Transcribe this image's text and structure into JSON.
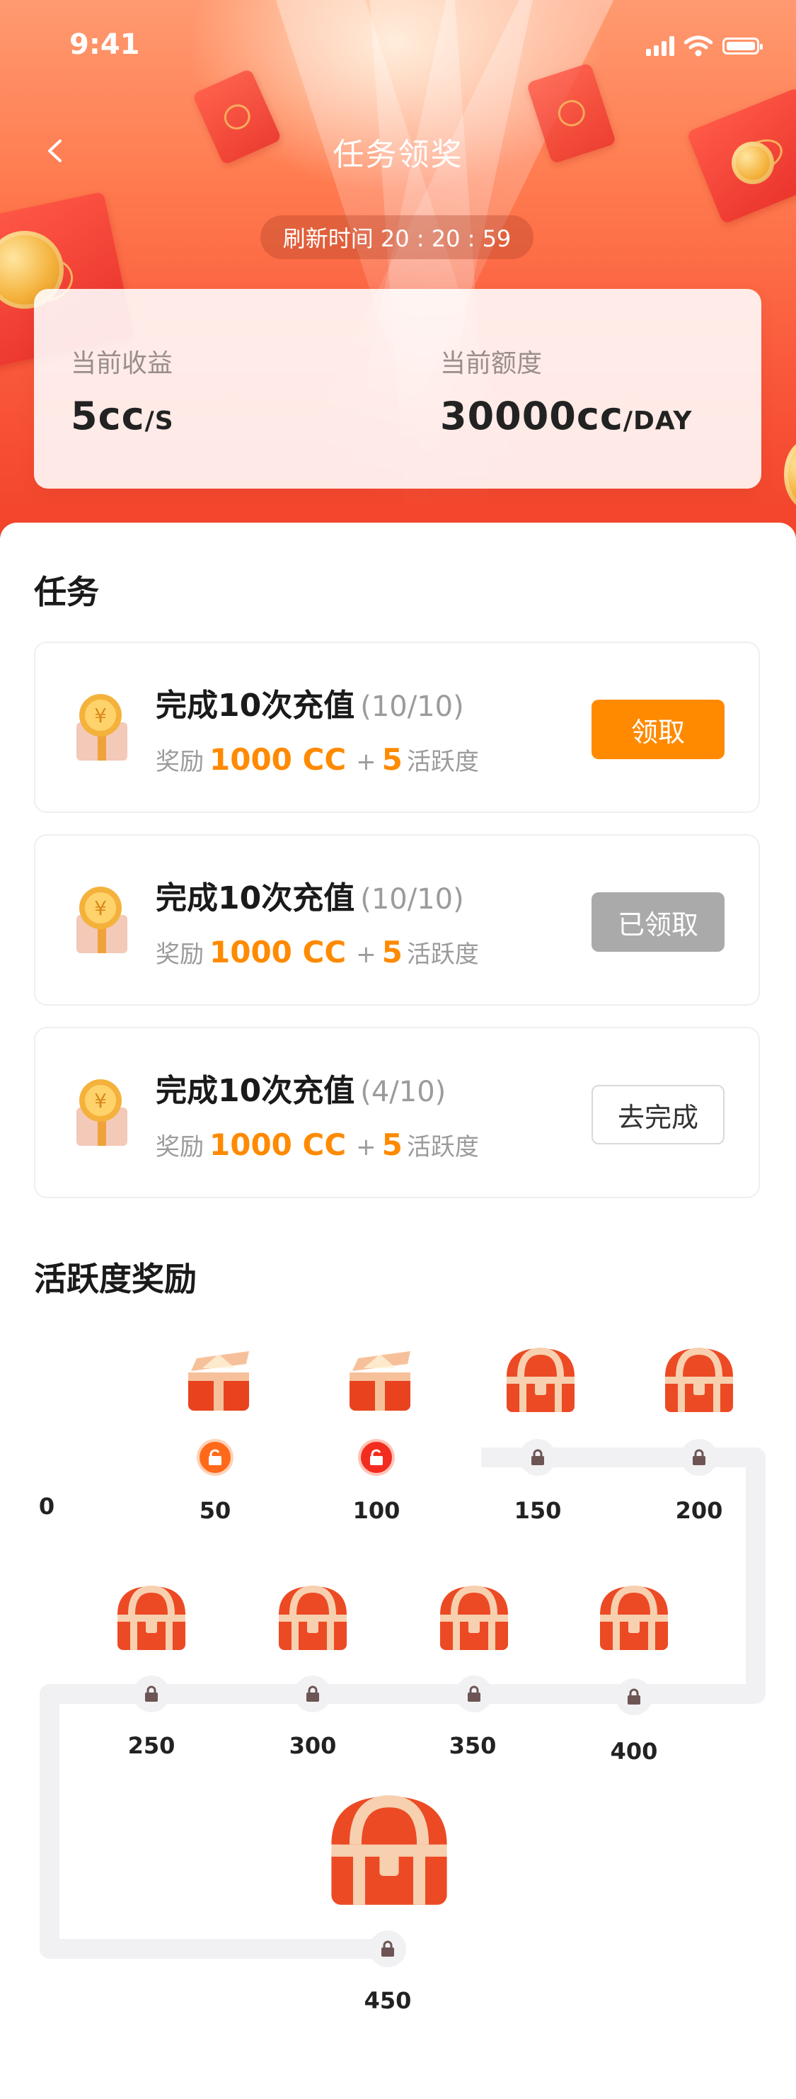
{
  "status_bar": {
    "time": "9:41"
  },
  "header": {
    "title": "任务领奖",
    "refresh_label": "刷新时间 20 : 20 : 59"
  },
  "earnings": {
    "income_label": "当前收益",
    "income_value": "5cc",
    "income_unit": "/S",
    "quota_label": "当前额度",
    "quota_value": "30000cc",
    "quota_unit": "/DAY"
  },
  "tasks_section": {
    "title": "任务",
    "tasks": [
      {
        "name": "完成10次充值",
        "progress": "(10/10)",
        "reward_prefix": "奖励",
        "reward_amount": "1000 CC",
        "plus": "+",
        "activity_points": "5",
        "activity_label": "活跃度",
        "button_label": "领取",
        "button_state": "claim"
      },
      {
        "name": "完成10次充值",
        "progress": "(10/10)",
        "reward_prefix": "奖励",
        "reward_amount": "1000 CC",
        "plus": "+",
        "activity_points": "5",
        "activity_label": "活跃度",
        "button_label": "已领取",
        "button_state": "claimed"
      },
      {
        "name": "完成10次充值",
        "progress": "(4/10)",
        "reward_prefix": "奖励",
        "reward_amount": "1000 CC",
        "plus": "+",
        "activity_points": "5",
        "activity_label": "活跃度",
        "button_label": "去完成",
        "button_state": "go"
      }
    ]
  },
  "activity_section": {
    "title": "活跃度奖励",
    "start_label": "0",
    "milestones": [
      {
        "value": "50",
        "state": "opened"
      },
      {
        "value": "100",
        "state": "opened"
      },
      {
        "value": "150",
        "state": "locked"
      },
      {
        "value": "200",
        "state": "locked"
      },
      {
        "value": "250",
        "state": "locked"
      },
      {
        "value": "300",
        "state": "locked"
      },
      {
        "value": "350",
        "state": "locked"
      },
      {
        "value": "400",
        "state": "locked"
      },
      {
        "value": "450",
        "state": "locked"
      }
    ]
  },
  "colors": {
    "accent": "#ff8a00",
    "header_red": "#f2432a",
    "progress_orange": "#ff8a00",
    "progress_red": "#f22d1f",
    "track_gray": "#f1f1f3"
  }
}
